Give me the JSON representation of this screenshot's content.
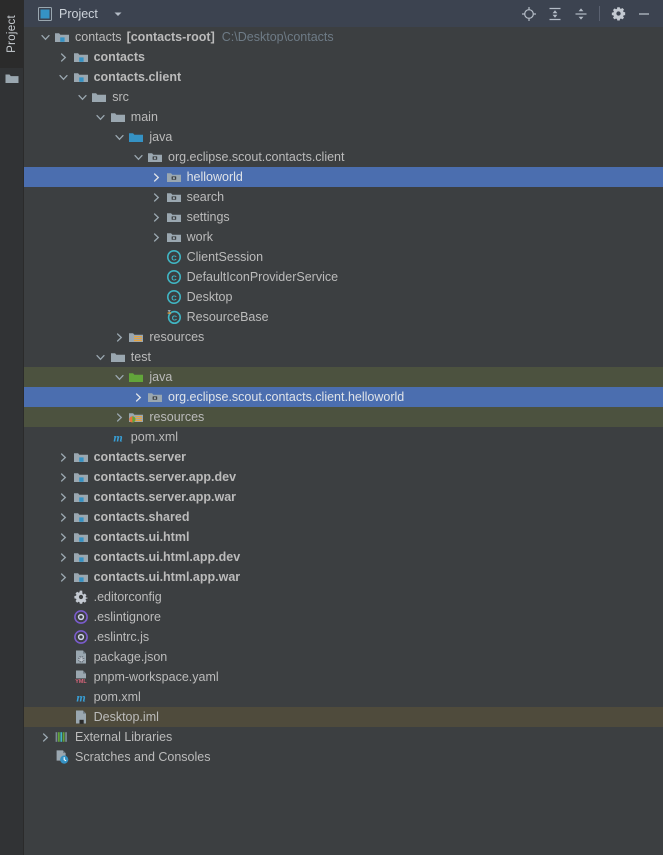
{
  "window": {
    "side_tab": "Project",
    "side_tab_icon": "folder-icon"
  },
  "toolbar": {
    "tab_label": "Project",
    "tab_icon": "project-view-icon",
    "dropdown_icon": "chevron-down-icon",
    "buttons": [
      {
        "name": "select-opened-file-button",
        "icon": "locate-target-icon",
        "tooltip": "Select Opened File"
      },
      {
        "name": "expand-all-button",
        "icon": "expand-all-icon",
        "tooltip": "Expand All"
      },
      {
        "name": "collapse-all-button",
        "icon": "collapse-all-icon",
        "tooltip": "Collapse All"
      },
      {
        "name": "options-button",
        "icon": "gear-icon",
        "tooltip": "Options"
      },
      {
        "name": "hide-button",
        "icon": "minimize-icon",
        "tooltip": "Hide"
      }
    ]
  },
  "colors": {
    "toolbar_bg": "#3c4350",
    "tree_bg": "#3c3f41",
    "strip_bg": "#313335",
    "selection_bg": "#4b6eaf",
    "test_source_bg": "#4c523f",
    "inactive_selection_bg": "#4f4b3c",
    "text": "#bbbbbb",
    "muted_text": "#6e7b86",
    "folder_gray": "#9aa7b0",
    "source_folder_blue": "#3592c4",
    "test_folder_green": "#62a53a",
    "class_teal": "#40b6c4",
    "maven_blue": "#389fd6",
    "eslint_purple": "#7a5ccc",
    "yaml_pink": "#d9657b"
  },
  "tree": {
    "rows": [
      {
        "indent": 0,
        "arrow": "expanded",
        "icon": "module-group-icon",
        "label": "contacts",
        "label_bold_suffix": "[contacts-root]",
        "sub": "C:\\Desktop\\contacts",
        "state": "normal"
      },
      {
        "indent": 1,
        "arrow": "collapsed",
        "icon": "module-icon",
        "label": "contacts",
        "bold": true,
        "state": "normal"
      },
      {
        "indent": 1,
        "arrow": "expanded",
        "icon": "module-icon",
        "label": "contacts.client",
        "bold": true,
        "state": "normal"
      },
      {
        "indent": 2,
        "arrow": "expanded",
        "icon": "folder-icon",
        "label": "src",
        "state": "normal"
      },
      {
        "indent": 3,
        "arrow": "expanded",
        "icon": "folder-icon",
        "label": "main",
        "state": "normal"
      },
      {
        "indent": 4,
        "arrow": "expanded",
        "icon": "source-folder-icon",
        "label": "java",
        "state": "normal"
      },
      {
        "indent": 5,
        "arrow": "expanded",
        "icon": "package-icon",
        "label": "org.eclipse.scout.contacts.client",
        "state": "normal"
      },
      {
        "indent": 6,
        "arrow": "collapsed",
        "icon": "package-icon",
        "label": "helloworld",
        "state": "selected"
      },
      {
        "indent": 6,
        "arrow": "collapsed",
        "icon": "package-icon",
        "label": "search",
        "state": "normal"
      },
      {
        "indent": 6,
        "arrow": "collapsed",
        "icon": "package-icon",
        "label": "settings",
        "state": "normal"
      },
      {
        "indent": 6,
        "arrow": "collapsed",
        "icon": "package-icon",
        "label": "work",
        "state": "normal"
      },
      {
        "indent": 6,
        "arrow": "none",
        "icon": "java-class-icon",
        "label": "ClientSession",
        "state": "normal"
      },
      {
        "indent": 6,
        "arrow": "none",
        "icon": "java-class-icon",
        "label": "DefaultIconProviderService",
        "state": "normal"
      },
      {
        "indent": 6,
        "arrow": "none",
        "icon": "java-class-icon",
        "label": "Desktop",
        "state": "normal"
      },
      {
        "indent": 6,
        "arrow": "none",
        "icon": "java-class-marked-icon",
        "label": "ResourceBase",
        "state": "normal"
      },
      {
        "indent": 4,
        "arrow": "collapsed",
        "icon": "resources-folder-icon",
        "label": "resources",
        "state": "normal"
      },
      {
        "indent": 3,
        "arrow": "expanded",
        "icon": "folder-icon",
        "label": "test",
        "state": "normal"
      },
      {
        "indent": 4,
        "arrow": "expanded",
        "icon": "test-source-folder-icon",
        "label": "java",
        "state": "test"
      },
      {
        "indent": 5,
        "arrow": "collapsed",
        "icon": "package-icon",
        "label": "org.eclipse.scout.contacts.client.helloworld",
        "state": "selected"
      },
      {
        "indent": 4,
        "arrow": "collapsed",
        "icon": "test-resources-folder-icon",
        "label": "resources",
        "state": "test"
      },
      {
        "indent": 3,
        "arrow": "none",
        "icon": "maven-icon",
        "label": "pom.xml",
        "state": "normal"
      },
      {
        "indent": 1,
        "arrow": "collapsed",
        "icon": "module-icon",
        "label": "contacts.server",
        "bold": true,
        "state": "normal"
      },
      {
        "indent": 1,
        "arrow": "collapsed",
        "icon": "module-icon",
        "label": "contacts.server.app.dev",
        "bold": true,
        "state": "normal"
      },
      {
        "indent": 1,
        "arrow": "collapsed",
        "icon": "module-icon",
        "label": "contacts.server.app.war",
        "bold": true,
        "state": "normal"
      },
      {
        "indent": 1,
        "arrow": "collapsed",
        "icon": "module-icon",
        "label": "contacts.shared",
        "bold": true,
        "state": "normal"
      },
      {
        "indent": 1,
        "arrow": "collapsed",
        "icon": "module-icon",
        "label": "contacts.ui.html",
        "bold": true,
        "state": "normal"
      },
      {
        "indent": 1,
        "arrow": "collapsed",
        "icon": "module-icon",
        "label": "contacts.ui.html.app.dev",
        "bold": true,
        "state": "normal"
      },
      {
        "indent": 1,
        "arrow": "collapsed",
        "icon": "module-icon",
        "label": "contacts.ui.html.app.war",
        "bold": true,
        "state": "normal"
      },
      {
        "indent": 1,
        "arrow": "none",
        "icon": "editorconfig-icon",
        "label": ".editorconfig",
        "state": "normal"
      },
      {
        "indent": 1,
        "arrow": "none",
        "icon": "eslint-icon",
        "label": ".eslintignore",
        "state": "normal"
      },
      {
        "indent": 1,
        "arrow": "none",
        "icon": "eslint-icon",
        "label": ".eslintrc.js",
        "state": "normal"
      },
      {
        "indent": 1,
        "arrow": "none",
        "icon": "package-json-icon",
        "label": "package.json",
        "state": "normal"
      },
      {
        "indent": 1,
        "arrow": "none",
        "icon": "yaml-file-icon",
        "label": "pnpm-workspace.yaml",
        "state": "normal"
      },
      {
        "indent": 1,
        "arrow": "none",
        "icon": "maven-icon",
        "label": "pom.xml",
        "state": "normal"
      },
      {
        "indent": 1,
        "arrow": "none",
        "icon": "iml-file-icon",
        "label": "Desktop.iml",
        "state": "inactive-selected"
      },
      {
        "indent": 0,
        "arrow": "collapsed",
        "icon": "external-libraries-icon",
        "label": "External Libraries",
        "state": "normal"
      },
      {
        "indent": 0,
        "arrow": "none",
        "icon": "scratches-icon",
        "label": "Scratches and Consoles",
        "state": "normal"
      }
    ]
  }
}
